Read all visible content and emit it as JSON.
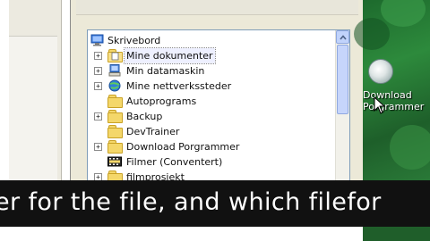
{
  "tree": {
    "root": {
      "label": "Skrivebord",
      "icon": "desktop-icon"
    },
    "items": [
      {
        "label": "Mine dokumenter",
        "icon": "my-documents-icon",
        "expander": "+"
      },
      {
        "label": "Min datamaskin",
        "icon": "my-computer-icon",
        "expander": "+"
      },
      {
        "label": "Mine nettverkssteder",
        "icon": "network-places-icon",
        "expander": "+"
      },
      {
        "label": "Autoprograms",
        "icon": "folder-icon",
        "expander": ""
      },
      {
        "label": "Backup",
        "icon": "folder-icon",
        "expander": "+"
      },
      {
        "label": "DevTrainer",
        "icon": "folder-icon",
        "expander": ""
      },
      {
        "label": "Download Porgrammer",
        "icon": "folder-icon",
        "expander": "+"
      },
      {
        "label": "Filmer (Conventert)",
        "icon": "film-folder-icon",
        "expander": ""
      },
      {
        "label": "filmprosjekt",
        "icon": "folder-icon",
        "expander": "+"
      }
    ]
  },
  "desktop": {
    "icon_label_line1": "Download",
    "icon_label_line2": "Porgrammer",
    "background_color": "#2d8a3c"
  },
  "caption": {
    "text": "er for the file, and which filefor"
  },
  "colors": {
    "dialog_bg": "#ece9d8",
    "tree_border": "#7f9db9",
    "scrollbar": "#c6d5fb",
    "caption_bg": "#111111"
  }
}
